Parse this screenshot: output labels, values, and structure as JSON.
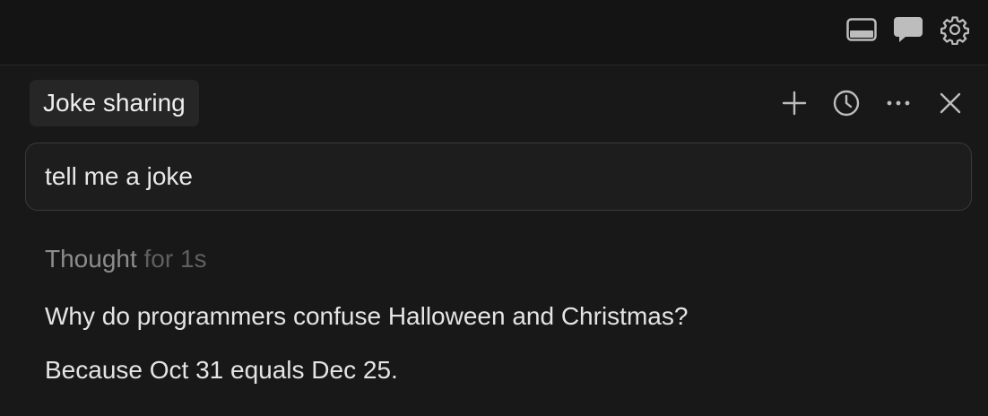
{
  "toolbar": {
    "icons": [
      "panel-layout-icon",
      "chat-bubble-icon",
      "gear-icon"
    ]
  },
  "chat": {
    "title": "Joke sharing",
    "actions": [
      "plus-icon",
      "history-clock-icon",
      "more-icon",
      "close-icon"
    ],
    "user_message": "tell me a joke",
    "thought_label": "Thought",
    "thought_duration": "for 1s",
    "answer_lines": [
      "Why do programmers confuse Halloween and Christmas?",
      "Because Oct 31 equals Dec 25."
    ]
  },
  "colors": {
    "background": "#181818",
    "topbar": "#141414",
    "title_chip": "#262626",
    "icon": "#bdbdbd"
  }
}
